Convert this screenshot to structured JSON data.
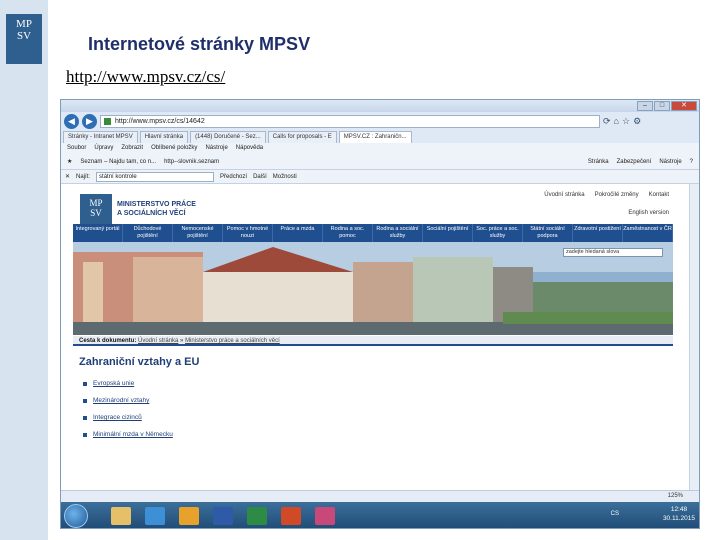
{
  "slide": {
    "logo_line1": "MP",
    "logo_line2": "SV",
    "title": "Internetové stránky MPSV",
    "url": "http://www.mpsv.cz/cs/"
  },
  "browser": {
    "address": "http://www.mpsv.cz/cs/14642",
    "tabs": [
      "Stránky - Intranet MPSV",
      "Hlavní stránka",
      "(1448) Doručené - Sez...",
      "Calls for proposals - E",
      "MPSV.CZ : Zahraničn..."
    ],
    "menu": [
      "Soubor",
      "Úpravy",
      "Zobrazit",
      "Oblíbené položky",
      "Nástroje",
      "Nápověda"
    ],
    "favorites": [
      "Seznam – Najdu tam, co n...",
      "http--slovnik.seznam"
    ],
    "commands": [
      "Stránka",
      "Zabezpečení",
      "Nástroje"
    ],
    "find_label": "Najít:",
    "find_value": "státní kontrole",
    "find_prev": "Předchozí",
    "find_next": "Další",
    "find_options": "Možnosti",
    "zoom": "125%"
  },
  "site": {
    "logo_line1": "MP",
    "logo_line2": "SV",
    "name_line1": "MINISTERSTVO PRÁCE",
    "name_line2": "A SOCIÁLNÍCH VĚCÍ",
    "toplinks": [
      "Úvodní stránka",
      "Pokročilé změny",
      "Kontakt"
    ],
    "english": "English version",
    "nav": [
      "Integrovaný portál",
      "Důchodové pojištění",
      "Nemocenské pojištění",
      "Pomoc v hmotné nouzi",
      "Práce a mzda",
      "Rodina a soc. pomoc",
      "Rodina a sociální služby",
      "Sociální pojištění",
      "Soc. práce a soc. služby",
      "Státní sociální podpora",
      "Zdravotní postižení",
      "Zaměstnanost v ČR"
    ],
    "search_placeholder": "zadejte hledaná slova",
    "breadcrumb_label": "Cesta k dokumentu:",
    "breadcrumb_items": [
      "Úvodní stránka",
      "Ministerstvo práce a sociálních věcí"
    ],
    "heading": "Zahraniční vztahy a EU",
    "links": [
      "Evropská unie",
      "Mezinárodní vztahy",
      "Integrace cizinců",
      "Minimální mzda v Německu"
    ]
  },
  "taskbar": {
    "lang": "CS",
    "time": "12:48",
    "date": "30.11.2015"
  },
  "colors": {
    "slide_title": "#1f2f6b",
    "site_nav": "#1f4f8f",
    "heading": "#1f3f78"
  }
}
